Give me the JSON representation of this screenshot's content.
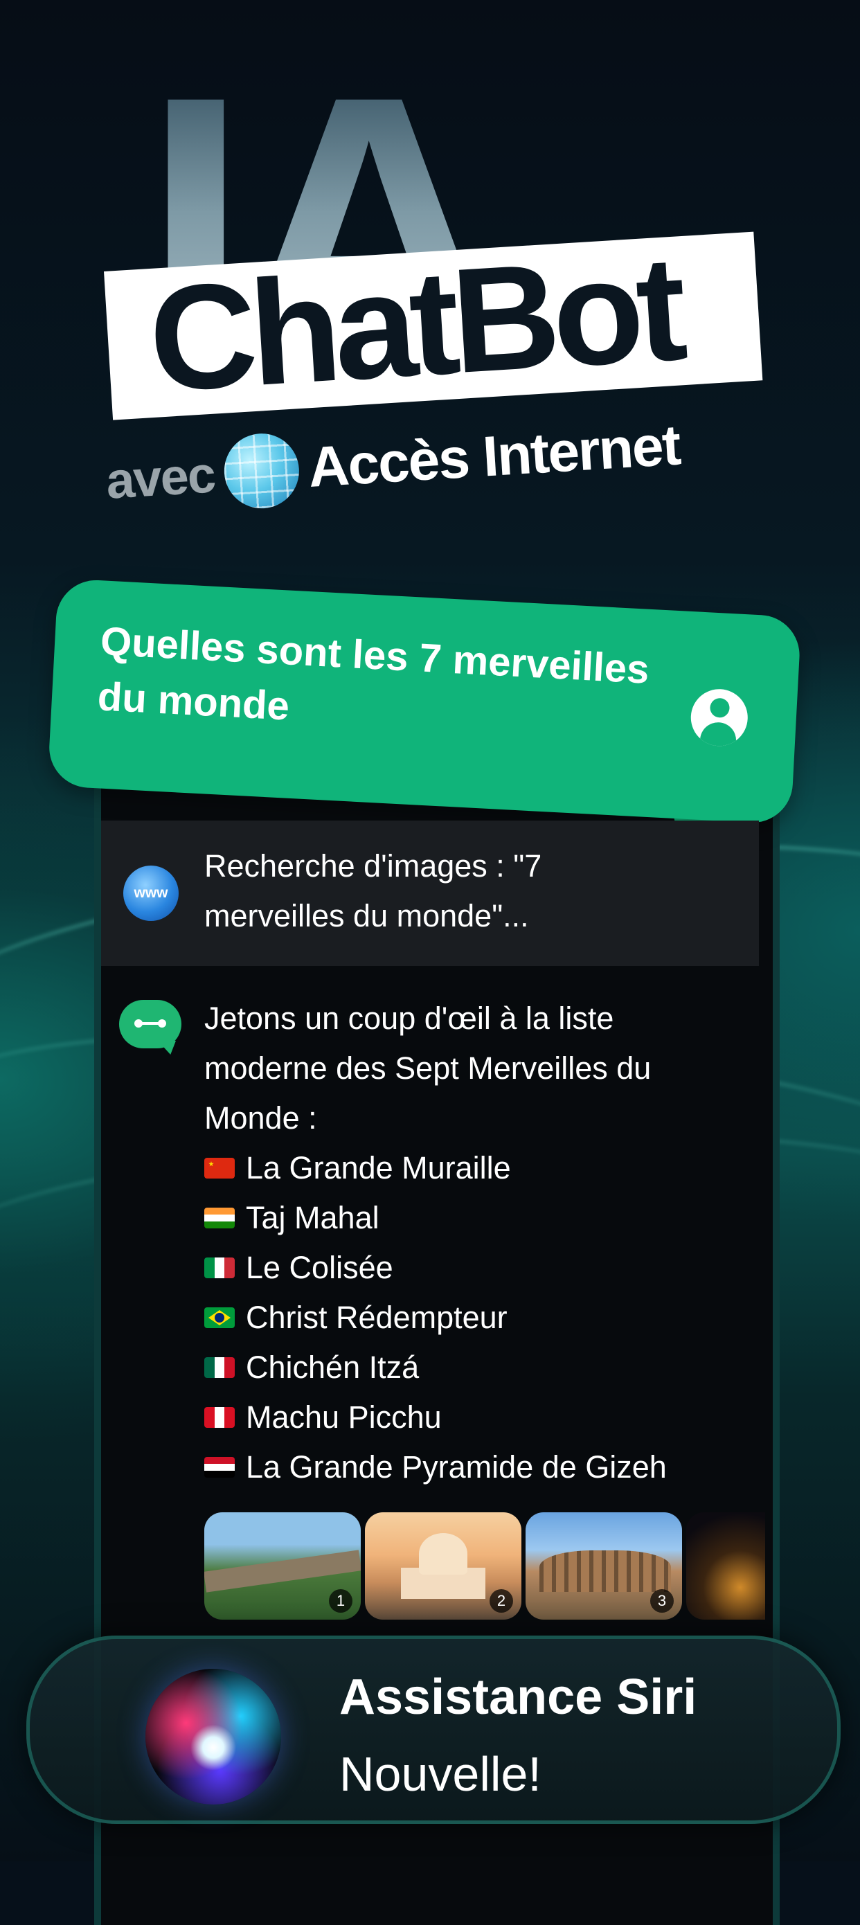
{
  "hero": {
    "ia": "IA",
    "chatbot": "ChatBot",
    "avec": "avec",
    "access": "Accès Internet"
  },
  "question": {
    "text": "Quelles sont les 7 merveilles du monde"
  },
  "search": {
    "icon_label": "www",
    "text": "Recherche d'images : \"7 merveilles du monde\"..."
  },
  "answer": {
    "intro": "Jetons un coup d'œil à la liste moderne des Sept Merveilles du Monde :",
    "items": [
      {
        "label": "La Grande Muraille",
        "flag": "china"
      },
      {
        "label": "Taj Mahal",
        "flag": "india"
      },
      {
        "label": "Le Colisée",
        "flag": "italy"
      },
      {
        "label": "Christ Rédempteur",
        "flag": "brazil"
      },
      {
        "label": "Chichén Itzá",
        "flag": "mexico"
      },
      {
        "label": "Machu Picchu",
        "flag": "peru"
      },
      {
        "label": "La Grande Pyramide de Gizeh",
        "flag": "egypt"
      }
    ]
  },
  "thumbnails": [
    {
      "num": "1",
      "subject": "great-wall"
    },
    {
      "num": "2",
      "subject": "taj-mahal"
    },
    {
      "num": "3",
      "subject": "colosseum"
    },
    {
      "num": "",
      "subject": "night-city"
    }
  ],
  "siri": {
    "title": "Assistance Siri",
    "subtitle": "Nouvelle!"
  },
  "colors": {
    "accent_green": "#10b47a",
    "bot_green": "#1fb672",
    "background": "#06101a"
  }
}
